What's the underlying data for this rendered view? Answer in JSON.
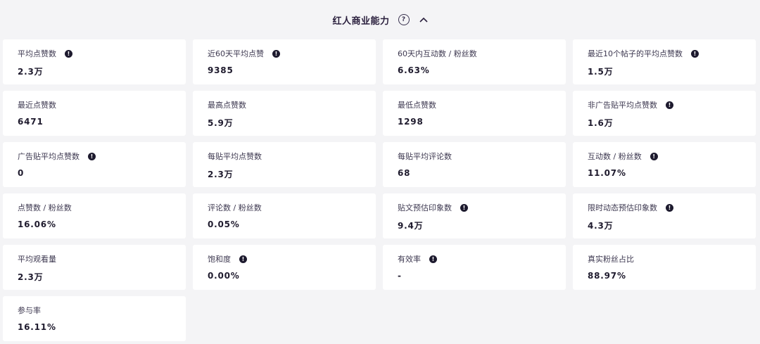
{
  "header": {
    "title": "红人商业能力",
    "help_icon": "question-circle-icon",
    "toggle_icon": "chevron-up-icon"
  },
  "metrics": [
    {
      "label": "平均点赞数",
      "value": "2.3万",
      "info": true
    },
    {
      "label": "近60天平均点赞",
      "value": "9385",
      "info": true
    },
    {
      "label": "60天内互动数 / 粉丝数",
      "value": "6.63%",
      "info": false
    },
    {
      "label": "最近10个帖子的平均点赞数",
      "value": "1.5万",
      "info": true
    },
    {
      "label": "最近点赞数",
      "value": "6471",
      "info": false
    },
    {
      "label": "最高点赞数",
      "value": "5.9万",
      "info": false
    },
    {
      "label": "最低点赞数",
      "value": "1298",
      "info": false
    },
    {
      "label": "非广告贴平均点赞数",
      "value": "1.6万",
      "info": true
    },
    {
      "label": "广告贴平均点赞数",
      "value": "0",
      "info": true
    },
    {
      "label": "每贴平均点赞数",
      "value": "2.3万",
      "info": false
    },
    {
      "label": "每贴平均评论数",
      "value": "68",
      "info": false
    },
    {
      "label": "互动数 / 粉丝数",
      "value": "11.07%",
      "info": true
    },
    {
      "label": "点赞数 / 粉丝数",
      "value": "16.06%",
      "info": false
    },
    {
      "label": "评论数 / 粉丝数",
      "value": "0.05%",
      "info": false
    },
    {
      "label": "贴文预估印象数",
      "value": "9.4万",
      "info": true
    },
    {
      "label": "限时动态预估印象数",
      "value": "4.3万",
      "info": true
    },
    {
      "label": "平均观看量",
      "value": "2.3万",
      "info": false
    },
    {
      "label": "饱和度",
      "value": "0.00%",
      "info": true
    },
    {
      "label": "有效率",
      "value": "-",
      "info": true
    },
    {
      "label": "真实粉丝占比",
      "value": "88.97%",
      "info": false
    },
    {
      "label": "参与率",
      "value": "16.11%",
      "info": false
    }
  ],
  "colors": {
    "background": "#f4f4f6",
    "card": "#ffffff",
    "text": "#1f1b2e",
    "info_icon": "#1d1a2e"
  }
}
